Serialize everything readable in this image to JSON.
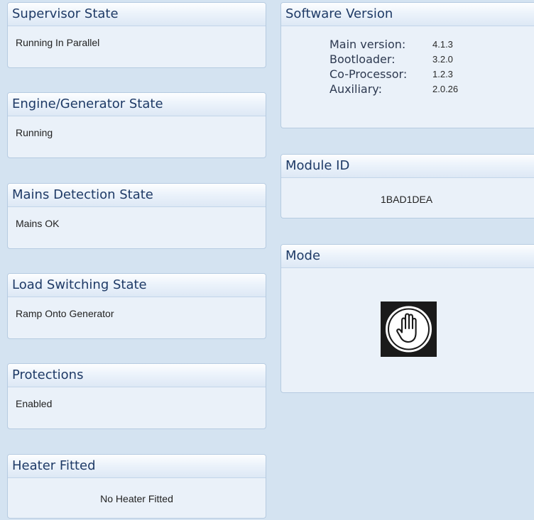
{
  "left_panels": [
    {
      "title": "Supervisor State",
      "value": "Running In Parallel"
    },
    {
      "title": "Engine/Generator State",
      "value": "Running"
    },
    {
      "title": "Mains Detection State",
      "value": "Mains OK"
    },
    {
      "title": "Load Switching State",
      "value": "Ramp Onto Generator"
    },
    {
      "title": "Protections",
      "value": "Enabled"
    },
    {
      "title": "Heater Fitted",
      "value": "No Heater Fitted"
    }
  ],
  "software_version": {
    "title": "Software Version",
    "rows": [
      {
        "label": "Main version:",
        "value": "4.1.3"
      },
      {
        "label": "Bootloader:",
        "value": "3.2.0"
      },
      {
        "label": "Co-Processor:",
        "value": "1.2.3"
      },
      {
        "label": "Auxiliary:",
        "value": "2.0.26"
      }
    ]
  },
  "module_id": {
    "title": "Module ID",
    "value": "1BAD1DEA"
  },
  "mode": {
    "title": "Mode",
    "icon": "manual-mode-hand-icon"
  }
}
